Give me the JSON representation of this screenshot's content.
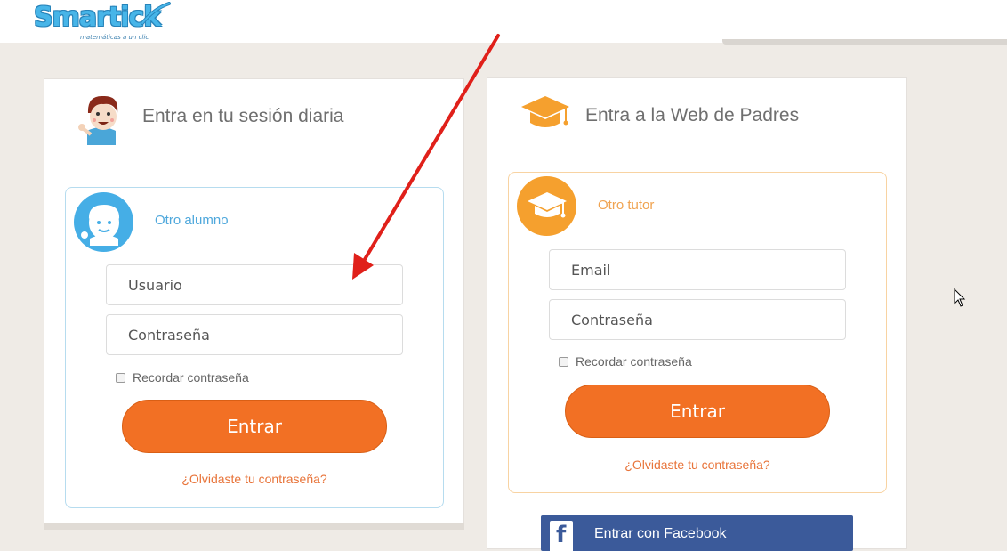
{
  "brand": {
    "name": "Smartick",
    "tagline": "matemáticas a un clic",
    "color": "#47b5e8"
  },
  "student_panel": {
    "title": "Entra en tu sesión diaria",
    "box_title": "Otro alumno",
    "username_placeholder": "Usuario",
    "password_placeholder": "Contraseña",
    "remember_label": "Recordar contraseña",
    "submit_label": "Entrar",
    "forgot_label": "¿Olvidaste tu contraseña?"
  },
  "parent_panel": {
    "title": "Entra a la Web de Padres",
    "box_title": "Otro tutor",
    "email_placeholder": "Email",
    "password_placeholder": "Contraseña",
    "remember_label": "Recordar contraseña",
    "submit_label": "Entrar",
    "forgot_label": "¿Olvidaste tu contraseña?",
    "facebook_label": "Entrar con Facebook"
  },
  "colors": {
    "accent_orange": "#f27024",
    "student_blue": "#45aee6",
    "parent_orange": "#f5a02e",
    "facebook_blue": "#3b5a9a"
  },
  "icons": [
    "mascot-boy-icon",
    "graduation-cap-icon",
    "kid-avatar-icon",
    "tutor-cap-avatar-icon",
    "facebook-icon",
    "mouse-cursor-icon"
  ]
}
